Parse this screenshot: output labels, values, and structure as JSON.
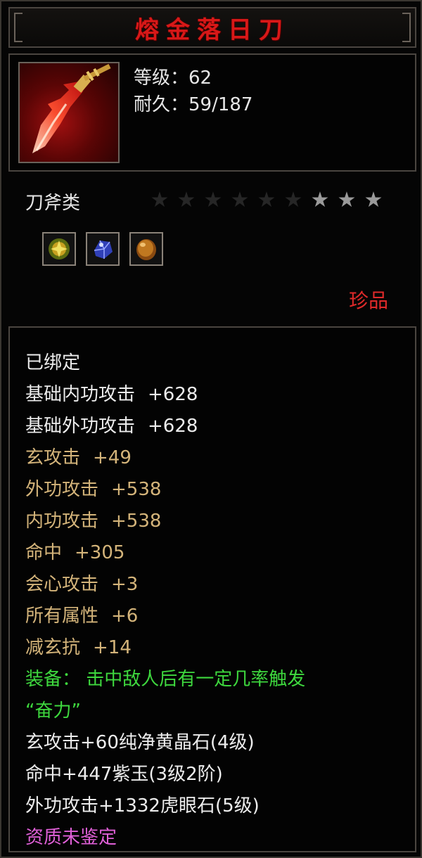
{
  "title": "熔金落日刀",
  "header": {
    "level_label": "等级：62",
    "durability_label": "耐久：59/187"
  },
  "category": "刀斧类",
  "stars": {
    "total": 9,
    "lit": 3
  },
  "gems": [
    {
      "icon": "gold-gem-icon",
      "color": "#c8a020"
    },
    {
      "icon": "blue-gem-icon",
      "color": "#4050d0"
    },
    {
      "icon": "amber-gem-icon",
      "color": "#c07820"
    }
  ],
  "rarity": "珍品",
  "colors": {
    "title": "#d81818",
    "gold": "#d4b47a",
    "green": "#3ed83e",
    "purple": "#e060d8",
    "rarity": "#e02a2a"
  },
  "attributes": {
    "bound": "已绑定",
    "base_inner": {
      "name": "基础内功攻击",
      "value": "+628"
    },
    "base_outer": {
      "name": "基础外功攻击",
      "value": "+628"
    },
    "xuan_attack": {
      "name": "玄攻击",
      "value": "+49"
    },
    "outer_attack": {
      "name": "外功攻击",
      "value": "+538"
    },
    "inner_attack": {
      "name": "内功攻击",
      "value": "+538"
    },
    "hit": {
      "name": "命中",
      "value": "+305"
    },
    "crit": {
      "name": "会心攻击",
      "value": "+3"
    },
    "all_attr": {
      "name": "所有属性",
      "value": "+6"
    },
    "reduce_xuan": {
      "name": "减玄抗",
      "value": "+14"
    },
    "equip_effect_1": "装备： 击中敌人后有一定几率触发",
    "equip_effect_2": "“奋力”",
    "gem_1": "玄攻击+60纯净黄晶石(4级)",
    "gem_2": "命中+447紫玉(3级2阶)",
    "gem_3": "外功攻击+1332虎眼石(5级)",
    "quality": "资质未鉴定"
  }
}
